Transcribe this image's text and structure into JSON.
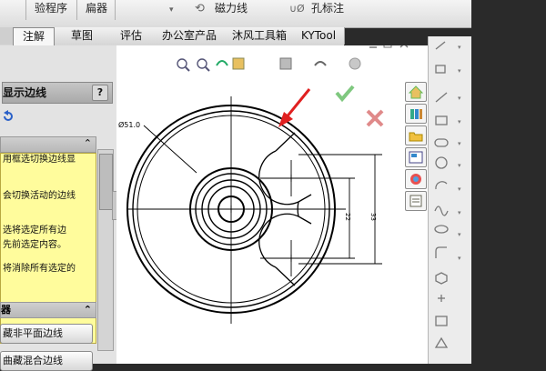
{
  "ribbon": {
    "items": [
      "验程序",
      "扁器",
      "磁力线",
      "孔标注"
    ]
  },
  "tabs": [
    {
      "label": "注解",
      "active": true
    },
    {
      "label": "草图",
      "active": false
    },
    {
      "label": "评估",
      "active": false
    },
    {
      "label": "办公室产品",
      "active": false
    },
    {
      "label": "沐风工具箱",
      "active": false
    },
    {
      "label": "KYTool",
      "active": false
    }
  ],
  "property_manager": {
    "title": "显示边线",
    "help": "?",
    "messages": [
      "用框选切换边线显",
      "会切换活动的边线",
      "选将选定所有边",
      "先前选定内容。",
      "将消除所有选定的"
    ],
    "section_title": "器",
    "buttons": [
      "藏非平面边线",
      "曲藏混合边线"
    ]
  },
  "drawing": {
    "dim_dia": "Ø51.0",
    "dim_a": "22",
    "dim_b": "33"
  },
  "colors": {
    "accept": "#7fc87f",
    "cancel": "#e08a8a",
    "arrow": "#e02020",
    "info_bg": "#fffc9c"
  }
}
